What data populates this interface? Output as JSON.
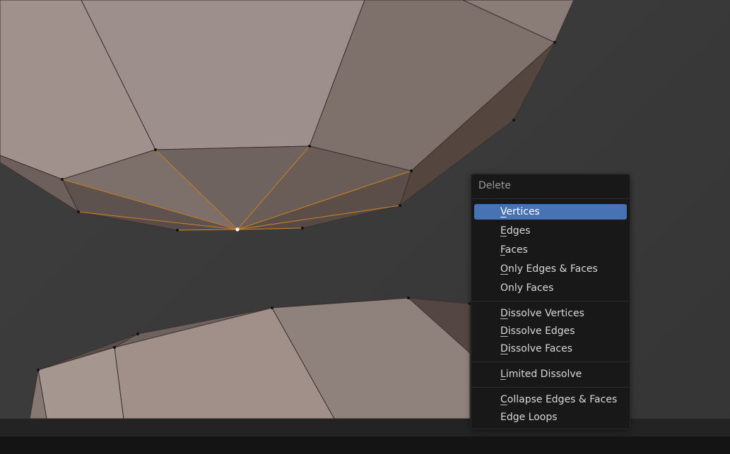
{
  "menu": {
    "title": "Delete",
    "groups": [
      [
        {
          "first": "V",
          "rest": "ertices"
        },
        {
          "first": "E",
          "rest": "dges"
        },
        {
          "first": "F",
          "rest": "aces"
        },
        {
          "first": "O",
          "rest": "nly Edges & Faces"
        },
        {
          "first": "",
          "rest": "Only Faces"
        }
      ],
      [
        {
          "first": "D",
          "rest": "issolve Vertices"
        },
        {
          "first": "D",
          "rest": "issolve Edges"
        },
        {
          "first": "D",
          "rest": "issolve Faces"
        }
      ],
      [
        {
          "first": "L",
          "rest": "imited Dissolve"
        }
      ],
      [
        {
          "first": "C",
          "rest": "ollapse Edges & Faces"
        },
        {
          "first": "",
          "rest": "Edge Loops"
        }
      ]
    ],
    "active_item": "Vertices"
  },
  "colors": {
    "menu_highlight": "#4772b3",
    "selection": "#e8912a",
    "mesh_face_light": "#968986",
    "mesh_face_dark": "#5f5552"
  }
}
